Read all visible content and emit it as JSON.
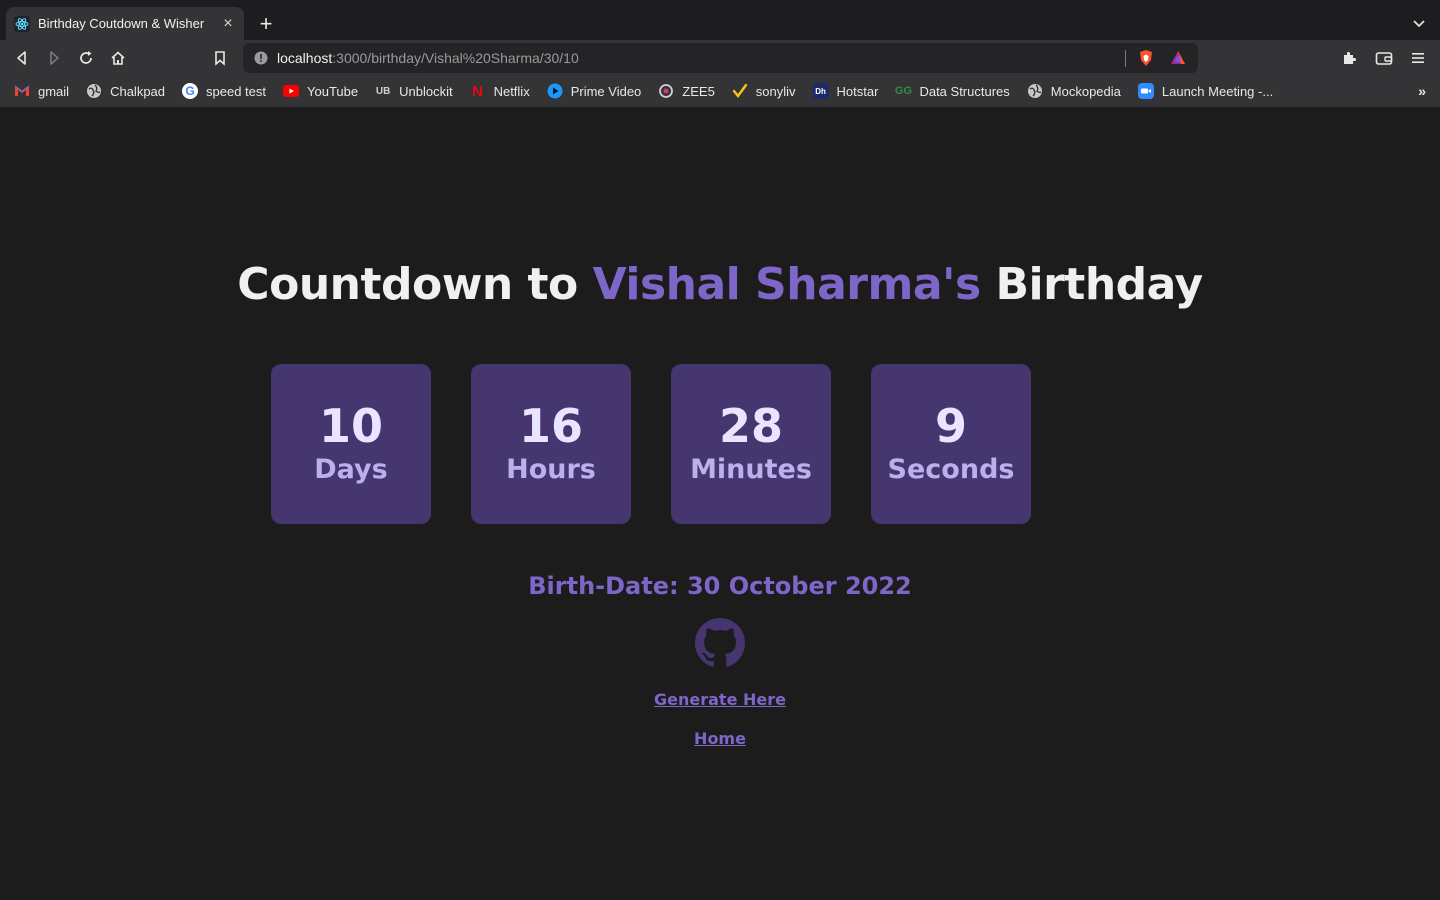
{
  "browser": {
    "tab": {
      "title": "Birthday Coutdown & Wisher"
    },
    "address": {
      "host": "localhost",
      "path": ":3000/birthday/Vishal%20Sharma/30/10"
    },
    "bookmarks": [
      {
        "label": "gmail",
        "icon": "gmail-icon"
      },
      {
        "label": "Chalkpad",
        "icon": "globe-icon"
      },
      {
        "label": "speed test",
        "icon": "google-icon"
      },
      {
        "label": "YouTube",
        "icon": "youtube-icon"
      },
      {
        "label": "Unblockit",
        "icon": "unblockit-icon"
      },
      {
        "label": "Netflix",
        "icon": "netflix-icon"
      },
      {
        "label": "Prime Video",
        "icon": "prime-video-icon"
      },
      {
        "label": "ZEE5",
        "icon": "zee5-icon"
      },
      {
        "label": "sonyliv",
        "icon": "sonyliv-icon"
      },
      {
        "label": "Hotstar",
        "icon": "hotstar-icon"
      },
      {
        "label": "Data Structures",
        "icon": "gfg-icon"
      },
      {
        "label": "Mockopedia",
        "icon": "globe-icon"
      },
      {
        "label": "Launch Meeting -...",
        "icon": "zoom-icon"
      }
    ]
  },
  "page": {
    "heading_prefix": "Countdown to ",
    "name": "Vishal Sharma's",
    "heading_suffix": " Birthday",
    "countdown": [
      {
        "value": "10",
        "label": "Days"
      },
      {
        "value": "16",
        "label": "Hours"
      },
      {
        "value": "28",
        "label": "Minutes"
      },
      {
        "value": "9",
        "label": "Seconds"
      }
    ],
    "birthdate": "Birth-Date: 30 October 2022",
    "generate_link": "Generate Here",
    "home_link": "Home"
  },
  "colors": {
    "accent": "#7e66c9",
    "card_bg": "#453670",
    "page_bg": "#1c1c1c"
  }
}
